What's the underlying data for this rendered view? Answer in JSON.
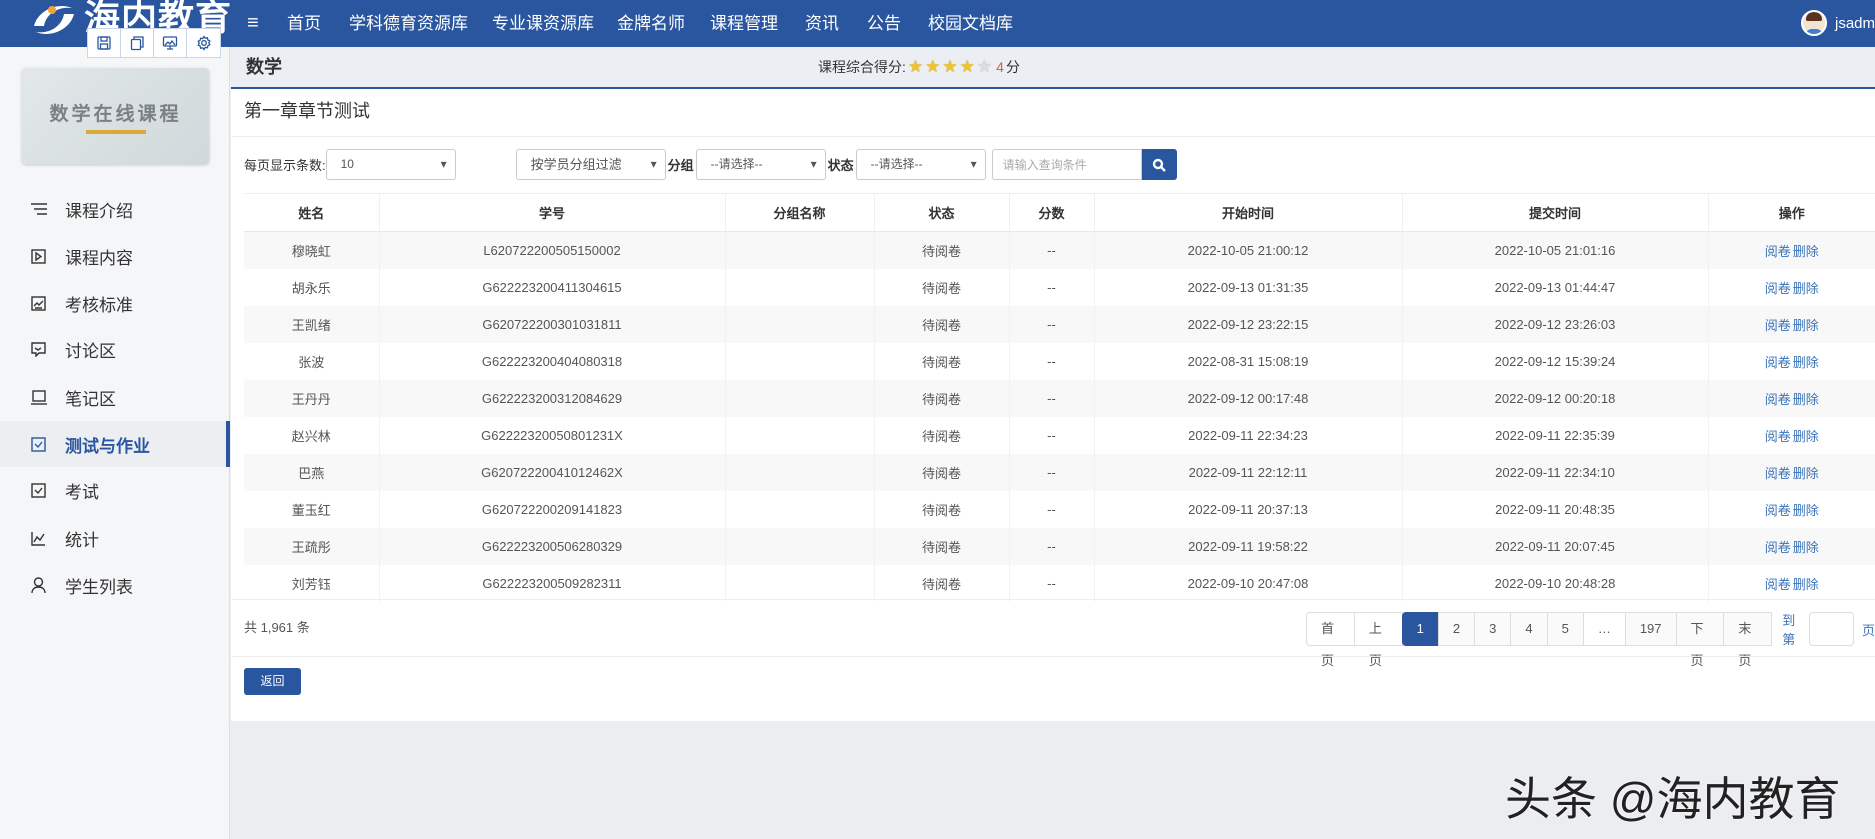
{
  "brand": {
    "logo_text": "海内教育",
    "primary_color": "#2a56a0"
  },
  "nav": {
    "menu_icon": "hamburger-icon",
    "items": [
      "首页",
      "学科德育资源库",
      "专业课资源库",
      "金牌名师",
      "课程管理",
      "资讯",
      "公告",
      "校园文档库"
    ]
  },
  "user": {
    "name": "jsadm"
  },
  "toolbox": [
    "save-icon",
    "copy-icon",
    "screen-icon",
    "gear-icon"
  ],
  "course": {
    "name": "数学",
    "image_title": "数学在线课程",
    "score_label": "课程综合得分:",
    "score": 4,
    "score_max": 5,
    "score_value": "4",
    "score_unit": "分"
  },
  "sidebar": {
    "items": [
      {
        "label": "课程介绍",
        "icon": "list-icon"
      },
      {
        "label": "课程内容",
        "icon": "play-icon"
      },
      {
        "label": "考核标准",
        "icon": "chart-icon"
      },
      {
        "label": "讨论区",
        "icon": "chat-icon"
      },
      {
        "label": "笔记区",
        "icon": "laptop-icon"
      },
      {
        "label": "测试与作业",
        "icon": "check-icon",
        "active": true
      },
      {
        "label": "考试",
        "icon": "check-icon"
      },
      {
        "label": "统计",
        "icon": "line-chart-icon"
      },
      {
        "label": "学生列表",
        "icon": "user-icon"
      }
    ]
  },
  "page": {
    "title": "第一章章节测试"
  },
  "filter": {
    "per_page_label": "每页显示条数:",
    "per_page": "10",
    "group_filter": "按学员分组过滤",
    "group_label": "分组",
    "group_value": "--请选择--",
    "status_label": "状态",
    "status_value": "--请选择--",
    "search_placeholder": "请输入查询条件"
  },
  "table": {
    "headers": [
      "姓名",
      "学号",
      "分组名称",
      "状态",
      "分数",
      "开始时间",
      "提交时间",
      "操作"
    ],
    "actions": [
      "阅卷",
      "删除"
    ],
    "rows": [
      [
        "穆晓虹",
        "L620722200505150002",
        "",
        "待阅卷",
        "--",
        "2022-10-05 21:00:12",
        "2022-10-05 21:01:16"
      ],
      [
        "胡永乐",
        "G622223200411304615",
        "",
        "待阅卷",
        "--",
        "2022-09-13 01:31:35",
        "2022-09-13 01:44:47"
      ],
      [
        "王凯绪",
        "G620722200301031811",
        "",
        "待阅卷",
        "--",
        "2022-09-12 23:22:15",
        "2022-09-12 23:26:03"
      ],
      [
        "张波",
        "G622223200404080318",
        "",
        "待阅卷",
        "--",
        "2022-08-31 15:08:19",
        "2022-09-12 15:39:24"
      ],
      [
        "王丹丹",
        "G622223200312084629",
        "",
        "待阅卷",
        "--",
        "2022-09-12 00:17:48",
        "2022-09-12 00:20:18"
      ],
      [
        "赵兴林",
        "G62222320050801231X",
        "",
        "待阅卷",
        "--",
        "2022-09-11 22:34:23",
        "2022-09-11 22:35:39"
      ],
      [
        "巴燕",
        "G62072220041012462X",
        "",
        "待阅卷",
        "--",
        "2022-09-11 22:12:11",
        "2022-09-11 22:34:10"
      ],
      [
        "董玉红",
        "G620722200209141823",
        "",
        "待阅卷",
        "--",
        "2022-09-11 20:37:13",
        "2022-09-11 20:48:35"
      ],
      [
        "王疏彤",
        "G622223200506280329",
        "",
        "待阅卷",
        "--",
        "2022-09-11 19:58:22",
        "2022-09-11 20:07:45"
      ],
      [
        "刘芳钰",
        "G622223200509282311",
        "",
        "待阅卷",
        "--",
        "2022-09-10 20:47:08",
        "2022-09-10 20:48:28"
      ]
    ]
  },
  "pagination": {
    "total": "共 1,961 条",
    "first": "首页",
    "prev": "上页",
    "pages": [
      "1",
      "2",
      "3",
      "4",
      "5",
      "…",
      "197"
    ],
    "current": "1",
    "next": "下页",
    "last": "末页",
    "goto_label": "到第",
    "goto_unit": "页"
  },
  "back_label": "返回",
  "watermark": "头条 @海内教育"
}
